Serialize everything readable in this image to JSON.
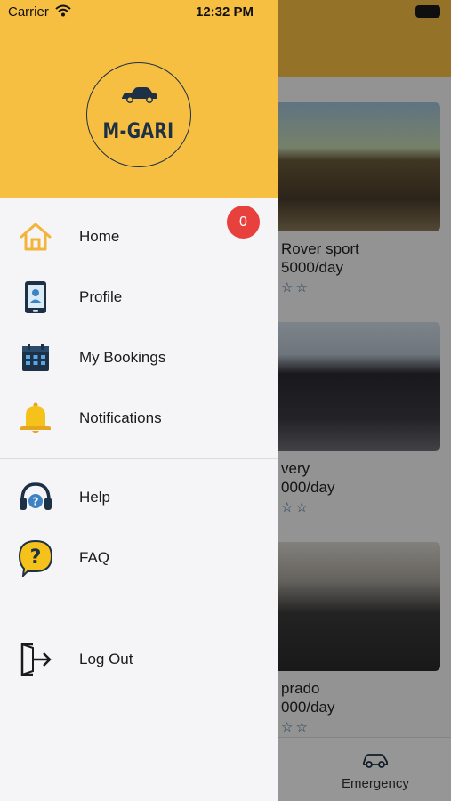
{
  "status_bar": {
    "carrier": "Carrier",
    "time": "12:32 PM"
  },
  "brand": {
    "logo_text": "M-GARI",
    "header_color": "#f7bf42"
  },
  "menu": {
    "home": "Home",
    "profile": "Profile",
    "bookings": "My Bookings",
    "notifications": "Notifications",
    "notifications_badge": "0",
    "help": "Help",
    "faq": "FAQ",
    "logout": "Log Out"
  },
  "background": {
    "cards": [
      {
        "name": " Rover sport",
        "price": "5000/day"
      },
      {
        "name": "very",
        "price": "000/day"
      },
      {
        "name": " prado",
        "price": "000/day"
      }
    ],
    "stars": "☆☆",
    "bottom_tab": "Emergency"
  },
  "icons": {
    "home": "home-icon",
    "profile": "profile-icon",
    "bookings": "calendar-icon",
    "notifications": "bell-icon",
    "help": "headset-icon",
    "faq": "question-bubble-icon",
    "logout": "logout-icon",
    "logo": "car-icon"
  }
}
